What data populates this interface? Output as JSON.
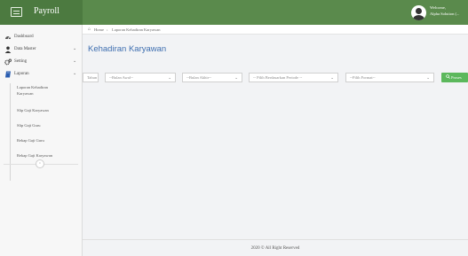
{
  "app": {
    "brand": "Payroll"
  },
  "user": {
    "welcome": "Welcome,",
    "name": "Alpha Solution (..."
  },
  "sidebar": {
    "items": [
      {
        "label": "Dashboard",
        "icon": "dashboard-icon"
      },
      {
        "label": "Data Master",
        "icon": "user-icon",
        "chevron": "⌄"
      },
      {
        "label": "Setting",
        "icon": "gear-icon",
        "chevron": "⌄"
      },
      {
        "label": "Laporan",
        "icon": "book-icon",
        "chevron": "⌄"
      }
    ],
    "sub_items": [
      {
        "label": "Laporan Kehadiran"
      },
      {
        "label": "Karyawan"
      },
      {
        "label": "Slip Gaji Karyawan"
      },
      {
        "label": "Slip Gaji Guru"
      },
      {
        "label": "Rekap Gaji Guru"
      },
      {
        "label": "Rekap Gaji Karyawan"
      }
    ],
    "collapse_icon": "‹"
  },
  "breadcrumb": {
    "home": "Home",
    "separator": "›",
    "current": "Laporan Kehadiran Karyawan"
  },
  "main": {
    "title": "Kehadiran Karyawan",
    "filters": {
      "tahun_placeholder": "Tahun",
      "bulan_awal": "--Bulan Awal--",
      "bulan_akhir": "--Bulan Akhir--",
      "periode": "-- Pilih Berdasarkan Periode --",
      "format": "--Pilih Format--",
      "chevron": "⌄"
    },
    "proses_button": "Proses"
  },
  "footer": {
    "text": "2020 © All Right Reserved"
  },
  "colors": {
    "topbar": "#5a8a4c",
    "brand_bg": "#4c7a40",
    "title": "#3f6fb0",
    "proses": "#5cb85c"
  }
}
